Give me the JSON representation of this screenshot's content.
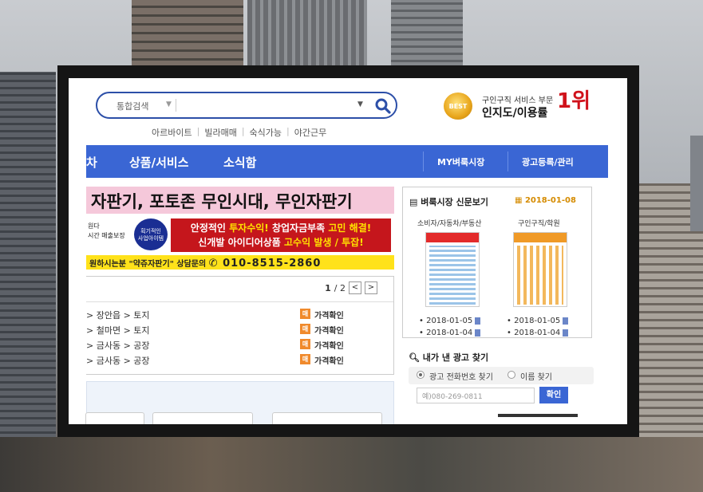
{
  "search": {
    "category": "통합검색",
    "placeholder": ""
  },
  "quick_links": [
    "아르바이트",
    "빌라매매",
    "숙식가능",
    "야간근무"
  ],
  "award": {
    "medal": "BEST",
    "small": "구인구직 서비스 부문",
    "big": "인지도/이용률",
    "rank": "1위"
  },
  "nav": {
    "items": [
      "차",
      "상품/서비스",
      "소식함"
    ],
    "right": [
      "MY벼룩시장",
      "광고등록/관리"
    ]
  },
  "banner": {
    "title": "자판기, 포토존 무인시대, 무인자판기",
    "left_line1": "원다",
    "left_line2": "시간 매출보장",
    "badge_line1": "획기적인",
    "badge_line2": "사업아이템",
    "red_line1_a": "안정적인 ",
    "red_line1_b": "투자수익!",
    "red_line1_c": " 창업자금부족 ",
    "red_line1_d": "고민 해결!",
    "red_line2_a": "신개발 아이디어상품 ",
    "red_line2_b": "고수익 발생 / 투잡!",
    "yellow_a": "원하시는분 \"약쥬자판기\"  상담문의 ",
    "yellow_phone": "010-8515-2860"
  },
  "listings": {
    "pager_current": "1",
    "pager_total": "/ 2",
    "prev": "<",
    "next": ">",
    "tag_icon": "매",
    "action": "가격확인",
    "rows": [
      "> 장안읍 > 토지",
      "> 철마면 > 토지",
      "> 금사동 > 공장",
      "> 금사동 > 공장"
    ]
  },
  "paper": {
    "title": "벼룩시장 신문보기",
    "date": "2018-01-08",
    "columns": [
      {
        "head": "소비자/자동차/부동산",
        "dates": [
          "2018-01-05",
          "2018-01-04"
        ]
      },
      {
        "head": "구인구직/학원",
        "dates": [
          "2018-01-05",
          "2018-01-04"
        ]
      }
    ]
  },
  "findad": {
    "title": "내가 낸 광고 찾기",
    "opt_phone": "광고 전화번호 찾기",
    "opt_name": "이름 찾기",
    "phone_placeholder": "예)080-269-0811",
    "confirm": "확인"
  }
}
